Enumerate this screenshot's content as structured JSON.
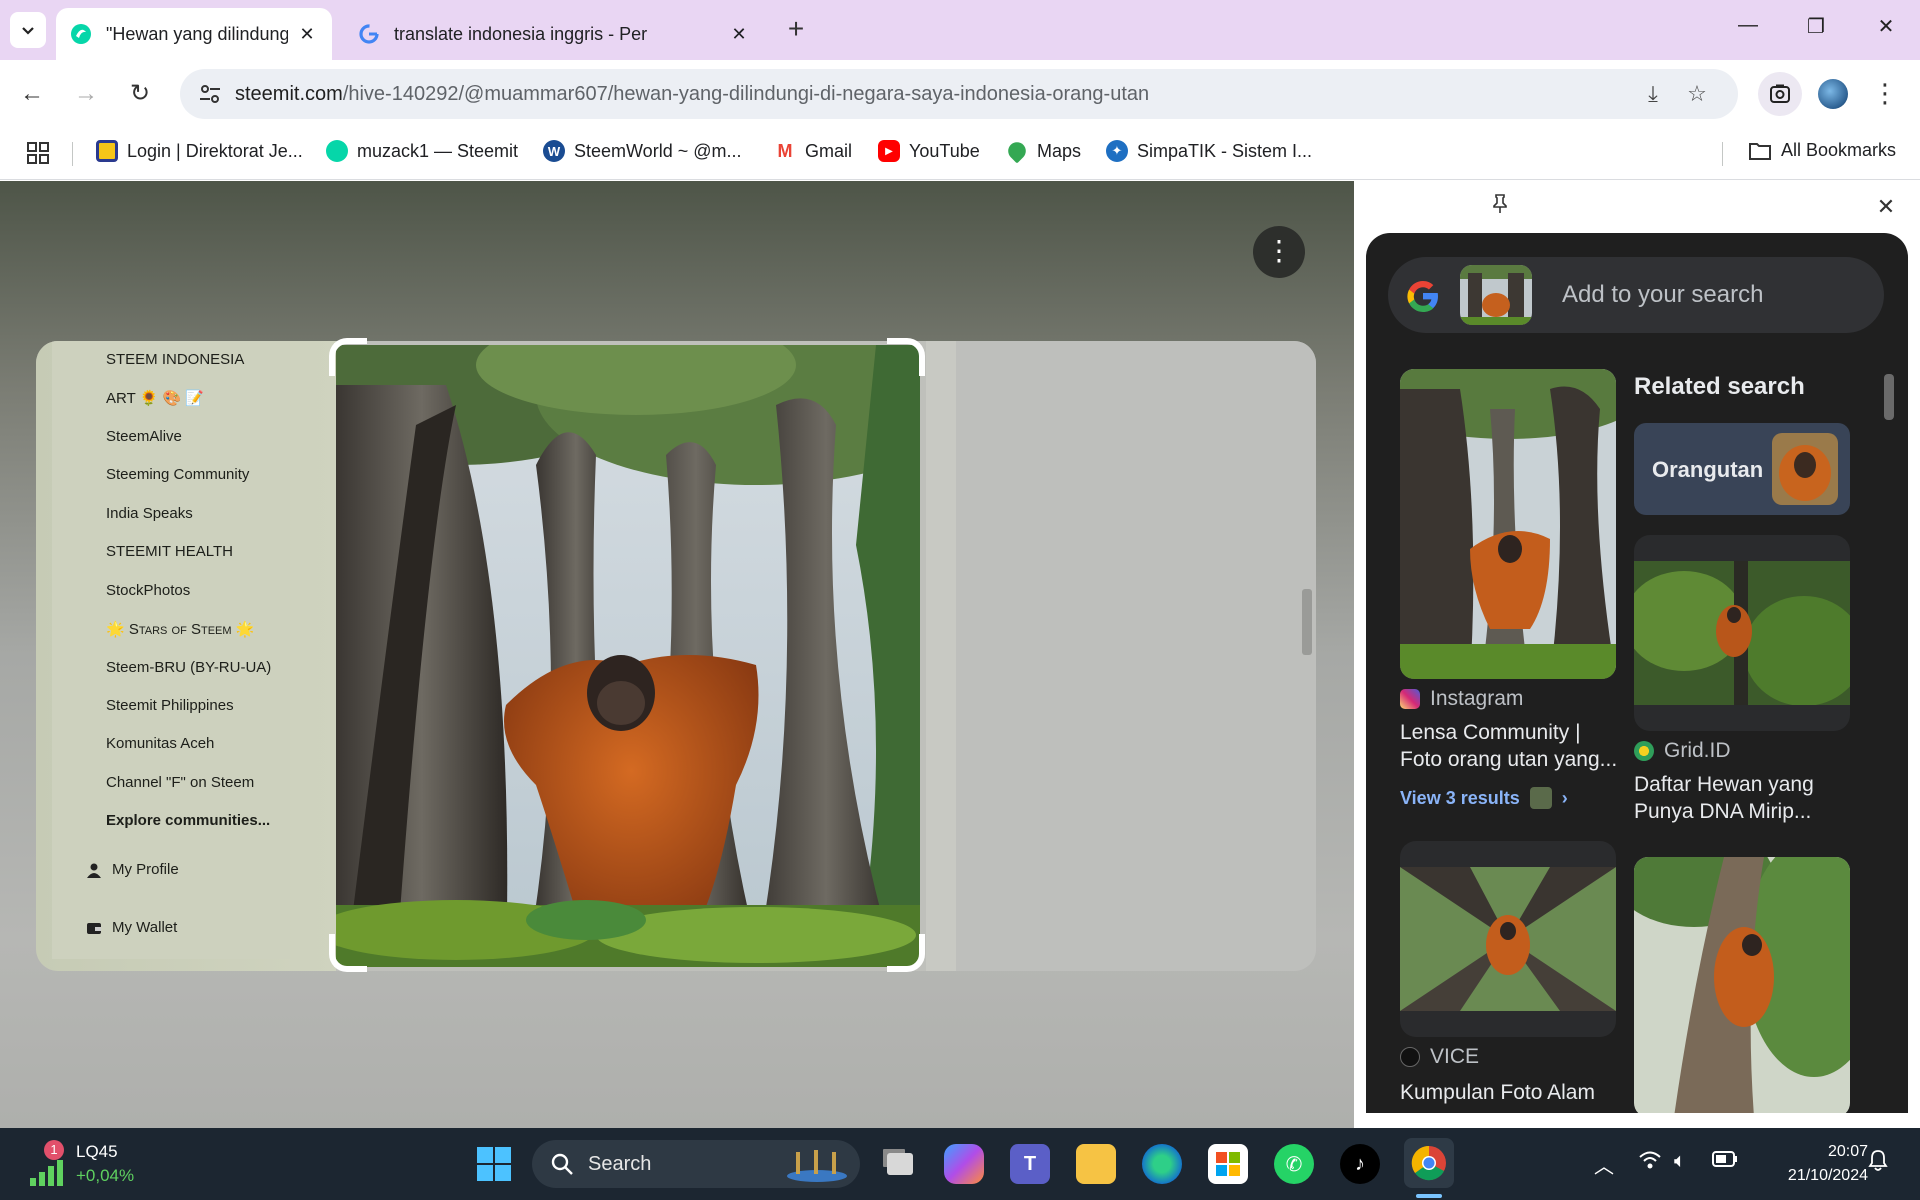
{
  "browser": {
    "tabs": [
      {
        "title": "\"Hewan yang dilindungi di nega",
        "active": true
      },
      {
        "title": "translate indonesia inggris - Per",
        "active": false
      }
    ],
    "url": {
      "domain": "steemit.com",
      "path": "/hive-140292/@muammar607/hewan-yang-dilindungi-di-negara-saya-indonesia-orang-utan"
    },
    "bookmarks": [
      {
        "label": "Login | Direktorat Je...",
        "icon": "yellow-square-icon"
      },
      {
        "label": "muzack1 — Steemit",
        "icon": "steemit-icon"
      },
      {
        "label": "SteemWorld ~ @m...",
        "icon": "steemworld-icon"
      },
      {
        "label": "Gmail",
        "icon": "gmail-icon"
      },
      {
        "label": "YouTube",
        "icon": "youtube-icon"
      },
      {
        "label": "Maps",
        "icon": "maps-icon"
      },
      {
        "label": "SimpaTIK - Sistem I...",
        "icon": "simpatik-icon"
      }
    ],
    "all_bookmarks": "All Bookmarks"
  },
  "snapshot": {
    "communities": [
      "STEEM INDONESIA",
      "ART 🌻 🎨 📝",
      "SteemAlive",
      "Steeming Community",
      "India Speaks",
      "STEEMIT HEALTH",
      "StockPhotos",
      "🌟 Stars of Steem 🌟",
      "Steem-BRU (BY-RU-UA)",
      "Steemit Philippines",
      "Komunitas Aceh",
      "Channel \"F\" on Steem",
      "Explore communities..."
    ],
    "menu": {
      "profile": "My Profile",
      "wallet": "My Wallet"
    }
  },
  "lens": {
    "search_placeholder": "Add to your search",
    "related_heading": "Related search",
    "related_chip": "Orangutan",
    "results": [
      {
        "source": "Instagram",
        "title_line1": "Lensa Community |",
        "title_line2": "Foto orang utan yang...",
        "view_more": "View 3 results"
      },
      {
        "source": "Grid.ID",
        "title_line1": "Daftar Hewan yang",
        "title_line2": "Punya DNA Mirip..."
      },
      {
        "source": "VICE",
        "title_line1": "Kumpulan Foto Alam",
        "title_line2": ""
      }
    ]
  },
  "taskbar": {
    "stock_name": "LQ45",
    "stock_change": "+0,04%",
    "notification_count": "1",
    "search_label": "Search",
    "time": "20:07",
    "date": "21/10/2024"
  },
  "colors": {
    "tabbar": "#e9d6f3",
    "panel_bg": "#1f1f1f",
    "link_blue": "#8ab4f8",
    "taskbar": "#1c2631"
  }
}
